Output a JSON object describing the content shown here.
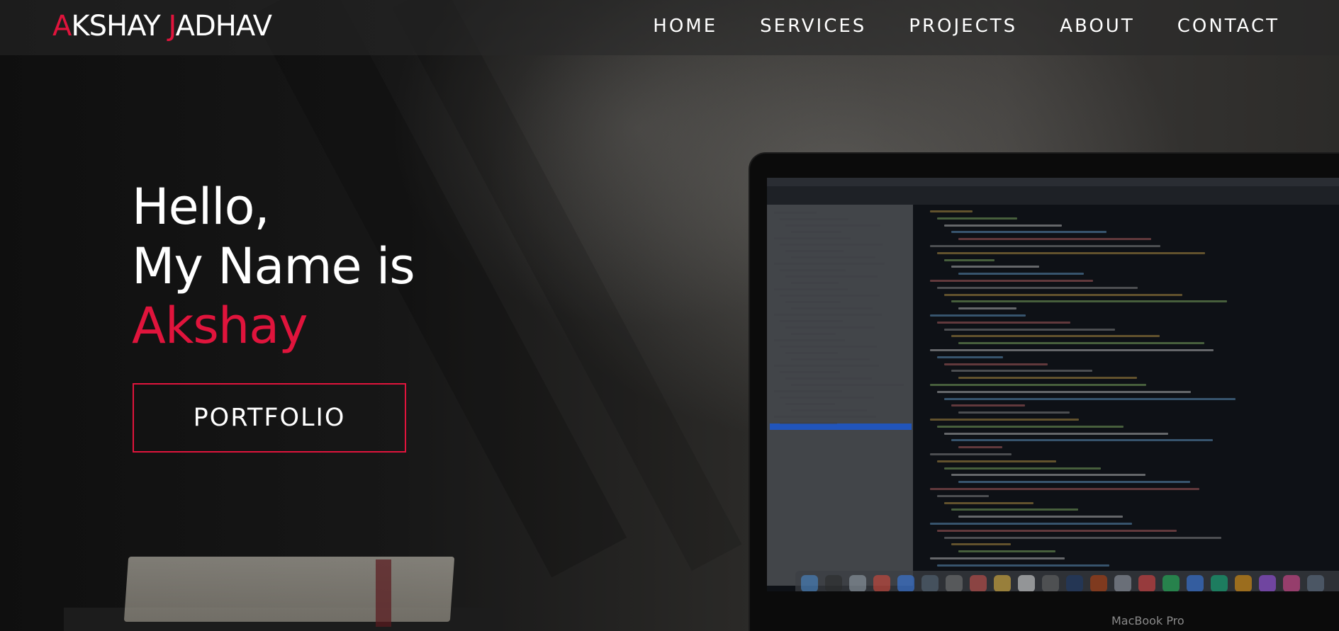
{
  "brand": {
    "first_initial": "A",
    "first_rest": "KSHAY ",
    "last_initial": "J",
    "last_rest": "ADHAV"
  },
  "nav": {
    "items": [
      {
        "label": "HOME"
      },
      {
        "label": "SERVICES"
      },
      {
        "label": "PROJECTS"
      },
      {
        "label": "ABOUT"
      },
      {
        "label": "CONTACT"
      }
    ]
  },
  "hero": {
    "line1": "Hello,",
    "line2": "My Name is",
    "name": "Akshay",
    "cta_label": "PORTFOLIO"
  },
  "laptop": {
    "model_text": "MacBook Pro"
  },
  "colors": {
    "accent": "#e0143c",
    "text": "#ffffff",
    "nav_bg": "#282828"
  }
}
